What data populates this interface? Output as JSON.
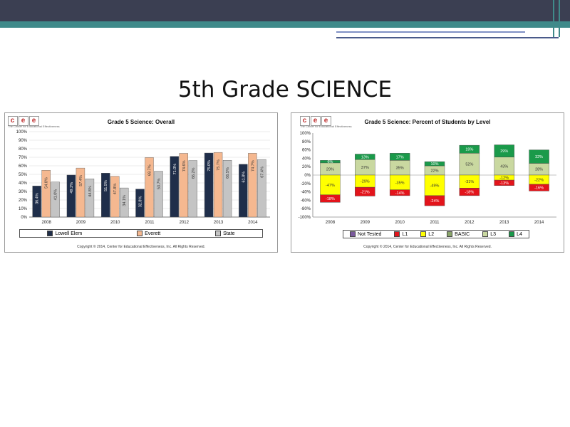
{
  "slide": {
    "title": "5th Grade SCIENCE"
  },
  "colors": {
    "header": "#3b3f52",
    "accent": "#3f8a8a",
    "lowell": "#1f2e4a",
    "everett": "#f5b890",
    "state": "#c4c4c4",
    "not_tested": "#7b5a9e",
    "l1": "#e3141b",
    "l2": "#ffff00",
    "basic": "#c9d8a0",
    "l3": "#c9d8a0",
    "l4": "#1a9a4a"
  },
  "logo": {
    "letters": [
      "c",
      "e",
      "e"
    ],
    "subtitle": "The Center for Educational Effectiveness"
  },
  "chart_data": [
    {
      "type": "bar",
      "title": "Grade 5 Science: Overall",
      "categories": [
        "2008",
        "2009",
        "2010",
        "2011",
        "2012",
        "2013",
        "2014"
      ],
      "ylim": [
        0,
        100
      ],
      "yticks": [
        "0%",
        "10%",
        "20%",
        "30%",
        "40%",
        "50%",
        "60%",
        "70%",
        "80%",
        "90%",
        "100%"
      ],
      "series": [
        {
          "name": "Lowell Elem",
          "values": [
            36.4,
            49.2,
            51.5,
            32.8,
            71.0,
            75.0,
            61.8
          ],
          "labels": [
            "36.4%",
            "49.2%",
            "51.5%",
            "32.8%",
            "71.0%",
            "75.0%",
            "61.8%"
          ]
        },
        {
          "name": "Everett",
          "values": [
            54.8,
            57.4,
            47.8,
            69.7,
            74.6,
            75.7,
            74.7
          ],
          "labels": [
            "54.8%",
            "57.4%",
            "47.8%",
            "69.7%",
            "74.6%",
            "75.7%",
            "74.7%"
          ]
        },
        {
          "name": "State",
          "values": [
            41.0,
            44.8,
            34.1,
            53.7,
            66.2,
            66.5,
            67.4
          ],
          "labels": [
            "41.0%",
            "44.8%",
            "34.1%",
            "53.7%",
            "66.2%",
            "66.5%",
            "67.4%"
          ]
        }
      ],
      "legend_position": "bottom",
      "grid": true,
      "copyright": "Copyright © 2014, Center for Educational Effectiveness, Inc. All Rights Reserved."
    },
    {
      "type": "bar",
      "stacked": true,
      "title": "Grade 5 Science: Percent of Students by Level",
      "categories": [
        "2008",
        "2009",
        "2010",
        "2011",
        "2012",
        "2013",
        "2014"
      ],
      "ylim": [
        -100,
        100
      ],
      "yticks": [
        "100%",
        "80%",
        "60%",
        "40%",
        "20%",
        "0%",
        "-20%",
        "-40%",
        "-60%",
        "-80%",
        "-100%"
      ],
      "positive_series": [
        {
          "name": "L3",
          "values": [
            29,
            37,
            35,
            22,
            52,
            43,
            28
          ],
          "labels": [
            "29%",
            "37%",
            "35%",
            "22%",
            "52%",
            "43%",
            "28%"
          ]
        },
        {
          "name": "L4",
          "values": [
            6,
            13,
            17,
            10,
            19,
            29,
            32
          ],
          "labels": [
            "6%",
            "13%",
            "17%",
            "10%",
            "19%",
            "29%",
            "32%"
          ]
        }
      ],
      "negative_series": [
        {
          "name": "L2",
          "values": [
            -47,
            -29,
            -35,
            -49,
            -31,
            -12,
            -22
          ],
          "labels": [
            "-47%",
            "-29%",
            "-35%",
            "-49%",
            "-31%",
            "-12%",
            "-22%"
          ]
        },
        {
          "name": "L1",
          "values": [
            -18,
            -21,
            -14,
            -24,
            -18,
            -13,
            -16
          ],
          "labels": [
            "-18%",
            "-21%",
            "-14%",
            "-24%",
            "-18%",
            "-13%",
            "-16%"
          ]
        }
      ],
      "legend": [
        "Not Tested",
        "L1",
        "L2",
        "BASIC",
        "L3",
        "L4"
      ],
      "legend_position": "bottom",
      "grid": false,
      "copyright": "Copyright © 2014, Center for Educational Effectiveness, Inc. All Rights Reserved."
    }
  ]
}
